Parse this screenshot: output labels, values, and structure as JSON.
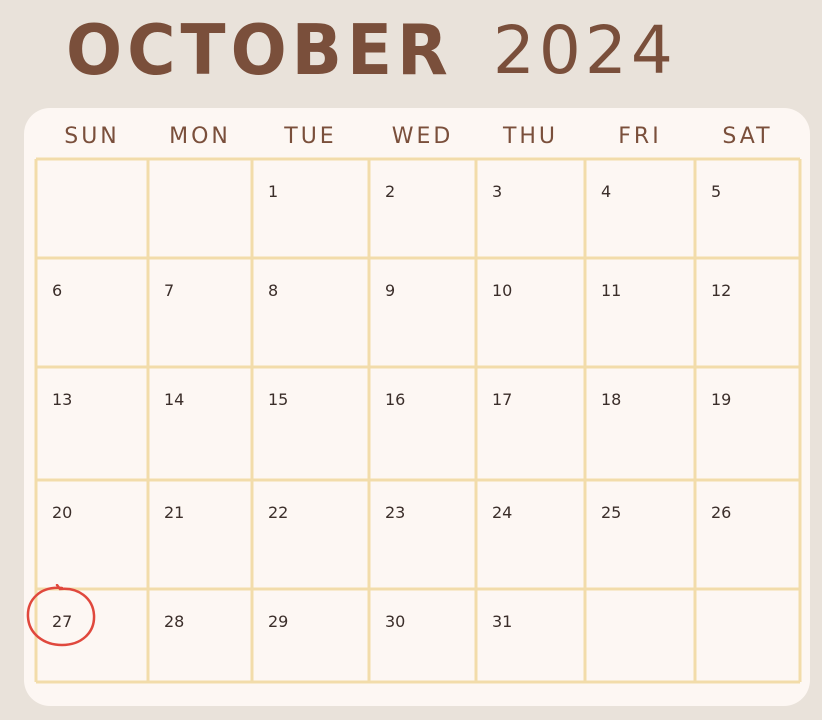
{
  "calendar": {
    "month": "OCTOBER",
    "year": "2024",
    "weekdays": [
      "SUN",
      "MON",
      "TUE",
      "WED",
      "THU",
      "FRI",
      "SAT"
    ],
    "days": [
      "1",
      "2",
      "3",
      "4",
      "5",
      "6",
      "7",
      "8",
      "9",
      "10",
      "11",
      "12",
      "13",
      "14",
      "15",
      "16",
      "17",
      "18",
      "19",
      "20",
      "21",
      "22",
      "23",
      "24",
      "25",
      "26",
      "27",
      "28",
      "29",
      "30",
      "31"
    ],
    "first_weekday_index": 2,
    "circled_day": "27"
  },
  "colors": {
    "background": "#e9e2da",
    "card": "#fdf7f3",
    "grid_line": "#f2dcaa",
    "title": "#7a4f3b",
    "day_text": "#3b2e2a",
    "circle": "#e0483d"
  }
}
